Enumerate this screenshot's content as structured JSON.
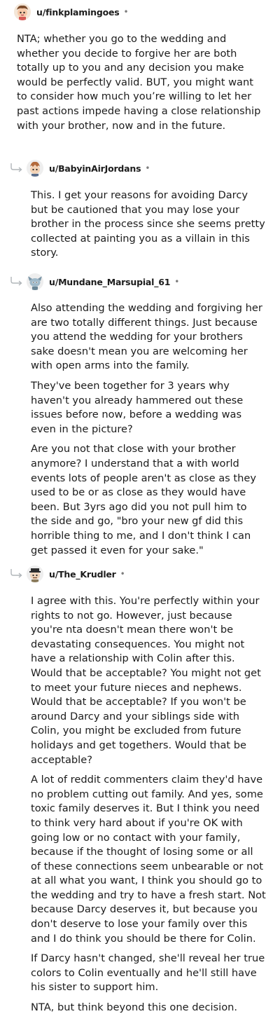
{
  "comments": [
    {
      "username": "u/finkplamingoes",
      "separator": "•",
      "paragraphs": [
        "NTA; whether you go to the wedding and whether you decide to forgive her are both totally up to you and any decision you make would be perfectly valid. BUT, you might want to consider how much you’re willing to let her past actions impede having a close relationship with your brother, now and in the future."
      ]
    },
    {
      "username": "u/BabyinAirJordans",
      "separator": "•",
      "paragraphs": [
        "This. I get your reasons for avoiding Darcy but be cautioned that you may lose your brother in the process since she seems pretty collected at painting you as a villain in this story."
      ]
    },
    {
      "username": "u/Mundane_Marsupial_61",
      "separator": "•",
      "paragraphs": [
        "Also attending the wedding and forgiving her are two totally different things. Just because you attend the wedding for your brothers sake doesn't mean you are welcoming her with open arms into the family.",
        "They've been together for 3 years why haven't you already hammered out these issues before now, before a wedding was even in the picture?",
        "Are you not that close with your brother anymore? I understand that a with world events lots of people aren't as close as they used to be or as close as they would have been. But 3yrs ago did you not pull him to the side and go, \"bro your new gf did this horrible thing to me, and I don't think I can get passed it even for your sake.\""
      ]
    },
    {
      "username": "u/The_Krudler",
      "separator": "•",
      "paragraphs": [
        "I agree with this. You're perfectly within your rights to not go. However, just because you're nta doesn't mean there won't be devastating consequences. You might not have a relationship with Colin after this. Would that be acceptable? You might not get to meet your future nieces and nephews. Would that be acceptable? If you won't be around Darcy and your siblings side with Colin, you might be excluded from future holidays and get togethers. Would that be acceptable?",
        "A lot of reddit commenters claim they'd have no problem cutting out family. And yes, some toxic family deserves it. But I think you need to think very hard about if you're OK with going low or no contact with your family, because if the thought of losing some or all of these connections seem unbearable or not at all what you want, I think you should go to the wedding and try to have a fresh start. Not because Darcy deserves it, but because you don't deserve to lose your family over this and I do think you should be there for Colin.",
        "If Darcy hasn't changed, she'll reveal her true colors to Colin eventually and he'll still have his sister to support him.",
        "NTA, but think beyond this one decision."
      ]
    }
  ]
}
